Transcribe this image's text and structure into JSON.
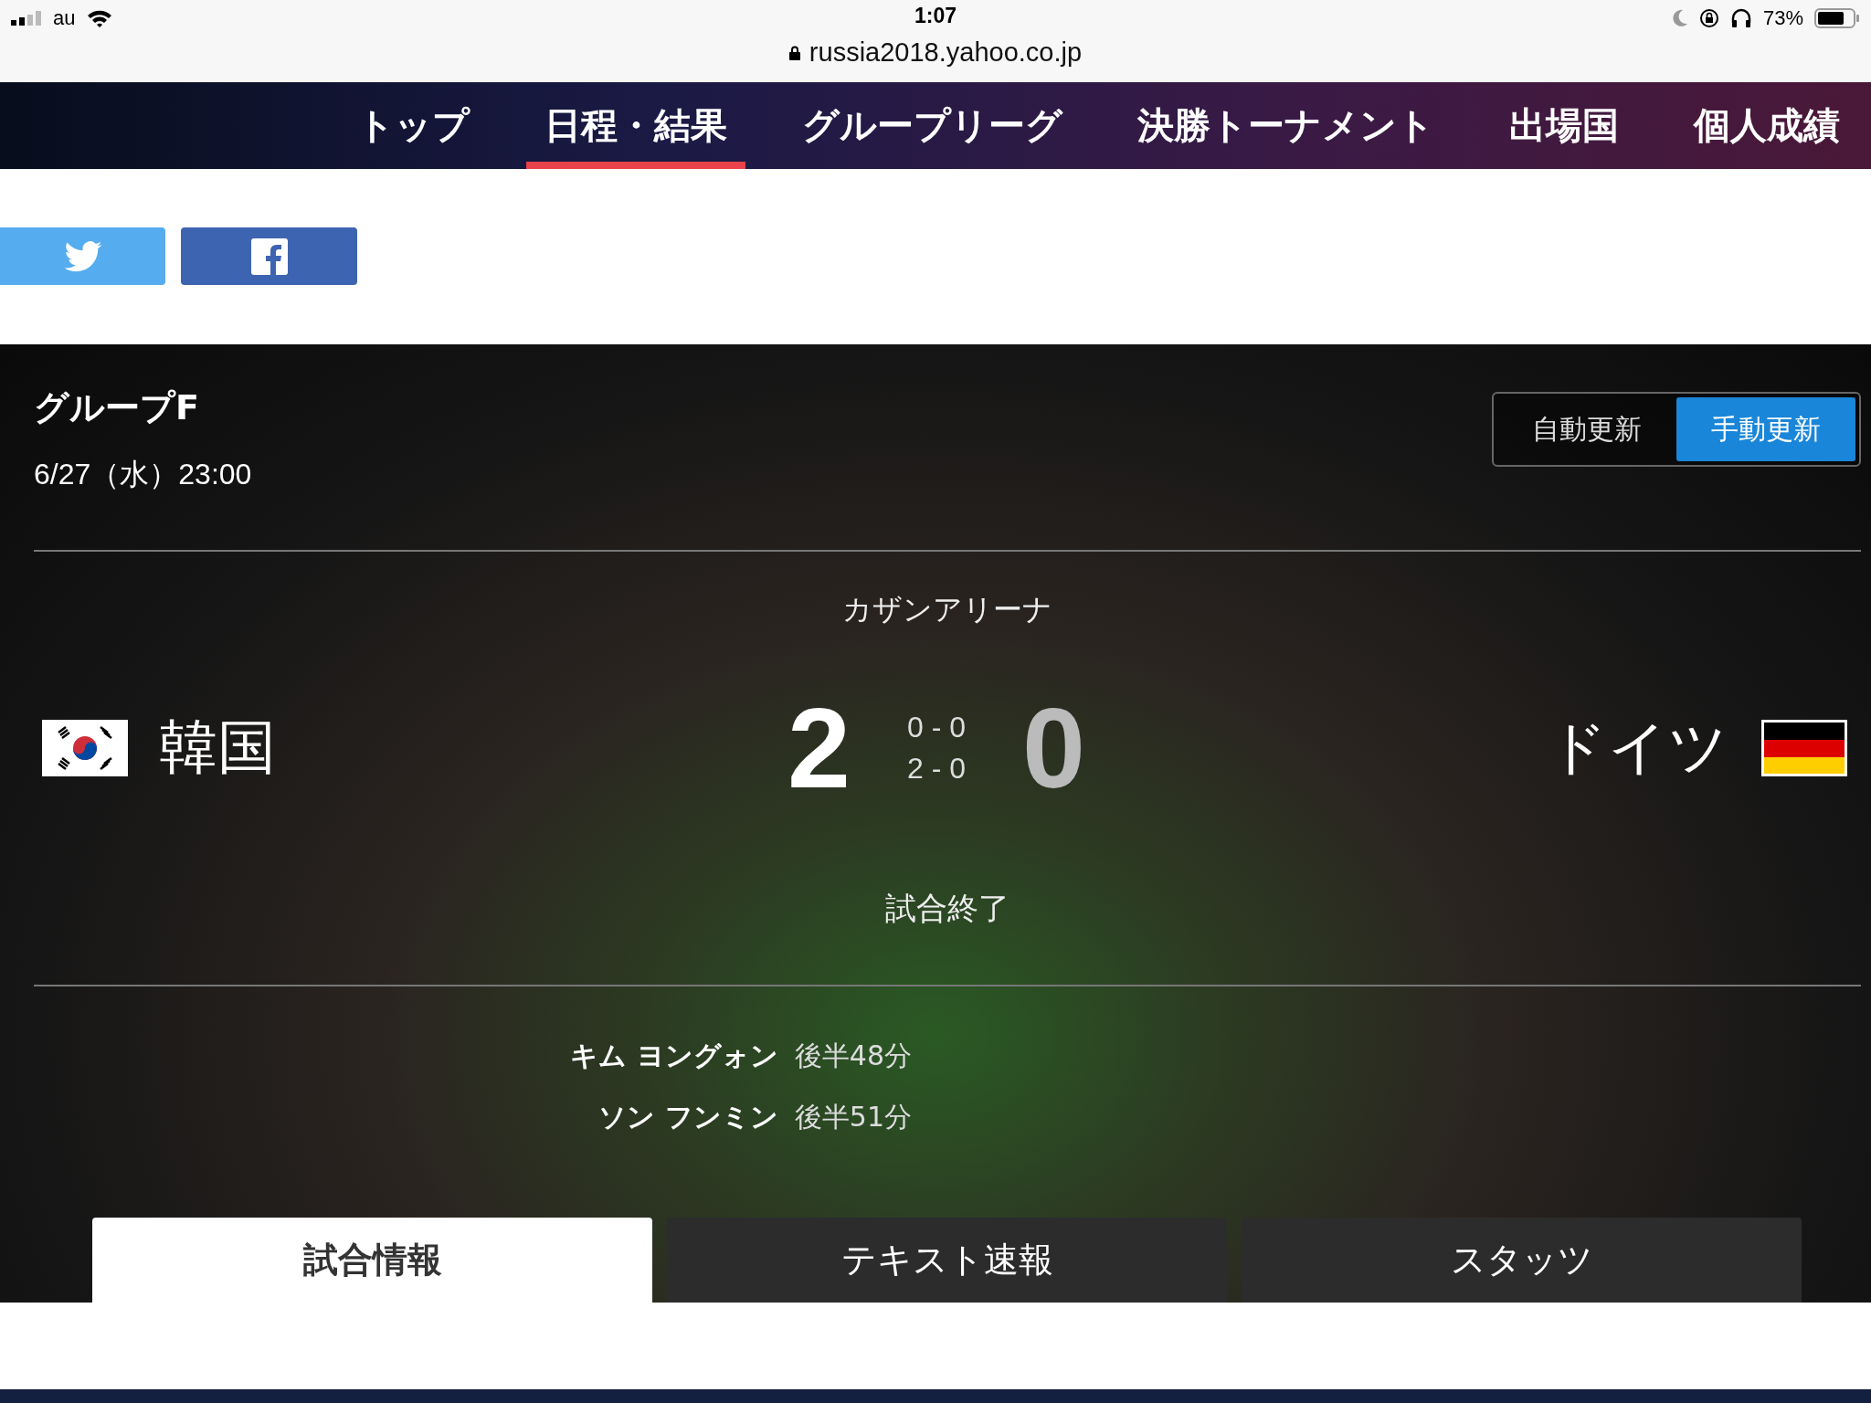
{
  "status_bar": {
    "carrier": "au",
    "time": "1:07",
    "battery": "73%",
    "url": "russia2018.yahoo.co.jp"
  },
  "nav": [
    {
      "label": "トップ",
      "selected": false
    },
    {
      "label": "日程・結果",
      "selected": true
    },
    {
      "label": "グループリーグ",
      "selected": false
    },
    {
      "label": "決勝トーナメント",
      "selected": false
    },
    {
      "label": "出場国",
      "selected": false
    },
    {
      "label": "個人成績",
      "selected": false
    }
  ],
  "match": {
    "group": "グループF",
    "datetime": "6/27（水）23:00",
    "update_modes": [
      {
        "label": "自動更新",
        "selected": false
      },
      {
        "label": "手動更新",
        "selected": true
      }
    ],
    "venue": "カザンアリーナ",
    "home": {
      "name": "韓国",
      "score": "2",
      "winner": true
    },
    "away": {
      "name": "ドイツ",
      "score": "0",
      "winner": false
    },
    "half_scores": [
      "0 - 0",
      "2 - 0"
    ],
    "status": "試合終了",
    "goals": [
      {
        "player": "キム ヨングォン",
        "time": "後半48分"
      },
      {
        "player": "ソン フンミン",
        "time": "後半51分"
      }
    ]
  },
  "tabs": [
    {
      "label": "試合情報",
      "selected": true
    },
    {
      "label": "テキスト速報",
      "selected": false
    },
    {
      "label": "スタッツ",
      "selected": false
    }
  ]
}
